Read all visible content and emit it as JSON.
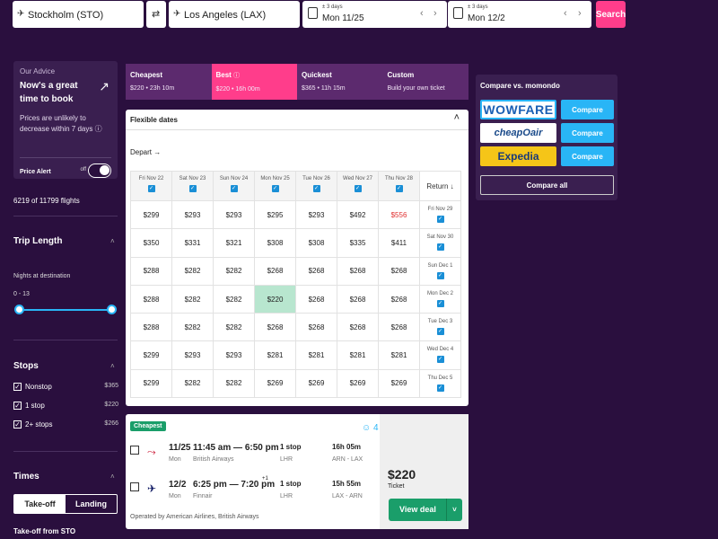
{
  "search": {
    "origin": "Stockholm (STO)",
    "destination": "Los Angeles (LAX)",
    "depart_flex": "± 3 days",
    "depart_date": "Mon 11/25",
    "return_flex": "± 3 days",
    "return_date": "Mon 12/2",
    "search_label": "Search"
  },
  "advice": {
    "heading": "Our Advice",
    "title": "Now's a great time to book",
    "body": "Prices are unlikely to decrease within 7 days",
    "price_alert_label": "Price Alert",
    "toggle_state": "off"
  },
  "filters": {
    "count": "6219 of 11799 flights",
    "trip_length_title": "Trip Length",
    "nights_label": "Nights at destination",
    "nights_range": "0 - 13",
    "stops_title": "Stops",
    "stops": [
      {
        "label": "Nonstop",
        "price": "$365"
      },
      {
        "label": "1 stop",
        "price": "$220"
      },
      {
        "label": "2+ stops",
        "price": "$266"
      }
    ],
    "times_title": "Times",
    "times_tabs": [
      "Take-off",
      "Landing"
    ],
    "takeoff_from": "Take-off from STO"
  },
  "sort_tabs": [
    {
      "name": "Cheapest",
      "sub": "$220 • 23h 10m"
    },
    {
      "name": "Best",
      "sub": "$220 • 16h 00m"
    },
    {
      "name": "Quickest",
      "sub": "$365 • 11h 15m"
    },
    {
      "name": "Custom",
      "sub": "Build your own ticket"
    }
  ],
  "flex": {
    "title": "Flexible dates",
    "depart_label": "Depart →",
    "return_label": "Return ↓",
    "depart_cols": [
      "Fri Nov 22",
      "Sat Nov 23",
      "Sun Nov 24",
      "Mon Nov 25",
      "Tue Nov 26",
      "Wed Nov 27",
      "Thu Nov 28"
    ],
    "return_rows": [
      "Fri Nov 29",
      "Sat Nov 30",
      "Sun Dec 1",
      "Mon Dec 2",
      "Tue Dec 3",
      "Wed Dec 4",
      "Thu Dec 5"
    ],
    "prices": [
      [
        "$299",
        "$293",
        "$293",
        "$295",
        "$293",
        "$492",
        "$556"
      ],
      [
        "$350",
        "$331",
        "$321",
        "$308",
        "$308",
        "$335",
        "$411"
      ],
      [
        "$288",
        "$282",
        "$282",
        "$268",
        "$268",
        "$268",
        "$268"
      ],
      [
        "$288",
        "$282",
        "$282",
        "$220",
        "$268",
        "$268",
        "$268"
      ],
      [
        "$288",
        "$282",
        "$282",
        "$268",
        "$268",
        "$268",
        "$268"
      ],
      [
        "$299",
        "$293",
        "$293",
        "$281",
        "$281",
        "$281",
        "$281"
      ],
      [
        "$299",
        "$282",
        "$282",
        "$269",
        "$269",
        "$269",
        "$269"
      ]
    ]
  },
  "result": {
    "badge": "Cheapest",
    "rating": "4",
    "legs": [
      {
        "date": "11/25",
        "day": "Mon",
        "times": "11:45 am — 6:50 pm",
        "plus": "",
        "airline": "British Airways",
        "stops": "1 stop",
        "airport": "LHR",
        "duration": "16h 05m",
        "route": "ARN - LAX"
      },
      {
        "date": "12/2",
        "day": "Mon",
        "times": "6:25 pm — 7:20 pm",
        "plus": "+1",
        "airline": "Finnair",
        "stops": "1 stop",
        "airport": "LHR",
        "duration": "15h 55m",
        "route": "LAX - ARN"
      }
    ],
    "operated": "Operated by American Airlines, British Airways",
    "price": "$220",
    "price_type": "Ticket",
    "view_label": "View deal"
  },
  "compare": {
    "title": "Compare vs. momondo",
    "brands": [
      "WOWFARE",
      "cheapOair",
      "Expedia"
    ],
    "button_label": "Compare",
    "all_label": "Compare all"
  },
  "colors": {
    "background": "#2a0f3e",
    "accent": "#ff3d8b",
    "deal_green": "#1a9e6a",
    "compare_blue": "#29b5f6"
  }
}
